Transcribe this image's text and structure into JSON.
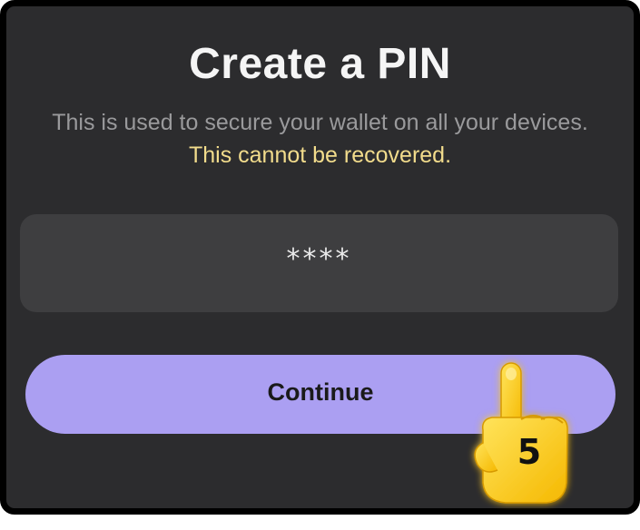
{
  "screen": {
    "title": "Create a PIN",
    "description": "This is used to secure your wallet on all your devices.",
    "warning": "This cannot be recovered."
  },
  "pin": {
    "value": "****"
  },
  "actions": {
    "continue_label": "Continue"
  },
  "overlay": {
    "step_number": "5",
    "hand_icon": "pointing-hand-icon"
  },
  "colors": {
    "background": "#2c2c2e",
    "field": "#3e3e40",
    "accent": "#ab9ff2",
    "warning": "#f2dc8c",
    "hand": "#ffd21f"
  }
}
